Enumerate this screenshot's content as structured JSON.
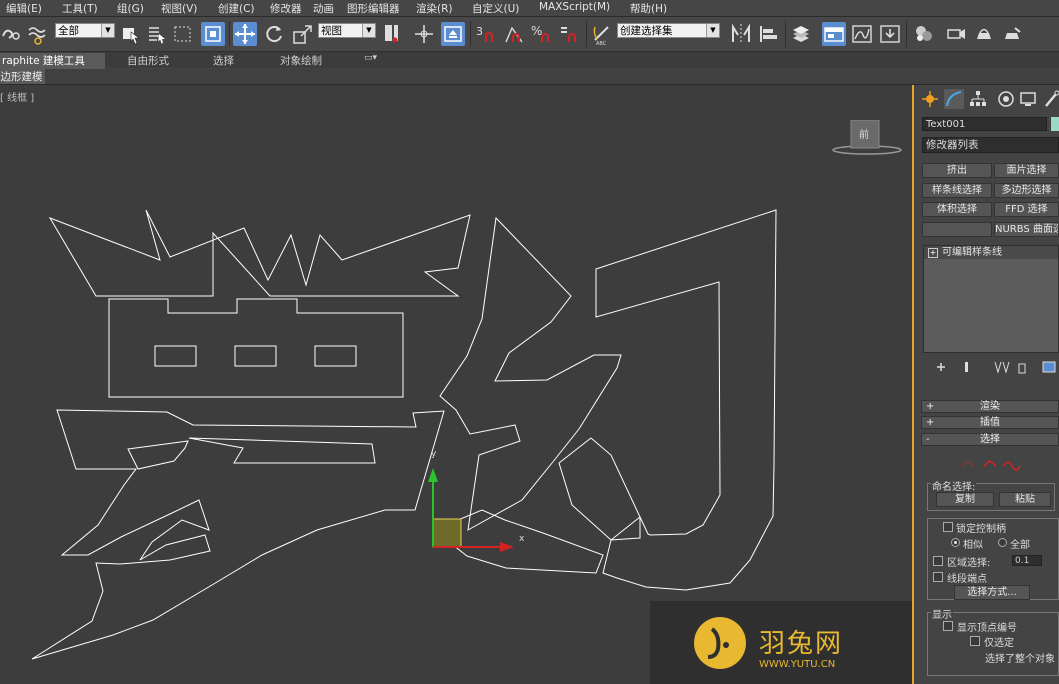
{
  "menu": [
    "编辑(E)",
    "工具(T)",
    "组(G)",
    "视图(V)",
    "创建(C)",
    "修改器",
    "动画",
    "图形编辑器",
    "渲染(R)",
    "自定义(U)",
    "MAXScript(M)",
    "帮助(H)"
  ],
  "toolbar": {
    "selection_filter": "全部",
    "ref_coord": "视图",
    "named_selection_placeholder": "创建选择集"
  },
  "ribbon": {
    "tabs": [
      "raphite 建模工具",
      "自由形式",
      "选择",
      "对象绘制"
    ],
    "sub_label": "多边形建模"
  },
  "viewport": {
    "label": "[ 线框 ]",
    "viewcube_label": "前",
    "axis_x": "x",
    "axis_y": "y",
    "watermark_text": "羽兔网",
    "watermark_url": "WWW.YUTU.CN"
  },
  "command_panel": {
    "object_name": "Text001",
    "object_color": "#99d9c6",
    "modifier_list": "修改器列表",
    "modifier_buttons": [
      "挤出",
      "面片选择",
      "样条线选择",
      "多边形选择",
      "体积选择",
      "FFD 选择",
      "",
      "NURBS 曲面选择"
    ],
    "stack_item": "可编辑样条线",
    "rollouts": [
      {
        "sign": "+",
        "label": "渲染"
      },
      {
        "sign": "+",
        "label": "插值"
      },
      {
        "sign": "-",
        "label": "选择"
      }
    ],
    "named_selections": {
      "title": "命名选择:",
      "copy": "复制",
      "paste": "粘贴"
    },
    "options": {
      "lock_handles": "锁定控制柄",
      "similar": "相似",
      "all": "全部",
      "area_selection": "区域选择:",
      "area_value": "0.1",
      "segment_end": "线段端点",
      "select_by": "选择方式..."
    },
    "display": {
      "title": "显示",
      "show_vertex_numbers": "显示顶点编号",
      "selected_only": "仅选定",
      "status": "选择了整个对象"
    }
  },
  "colors": {
    "viewport_bg": "#3d3d3d",
    "active_border": "#e4a52a",
    "shape_stroke": "#ffffff",
    "gizmo_x": "#d42222",
    "gizmo_y": "#2ac42a",
    "accent_blue": "#5b8ed0",
    "watermark": "#e8b830"
  }
}
